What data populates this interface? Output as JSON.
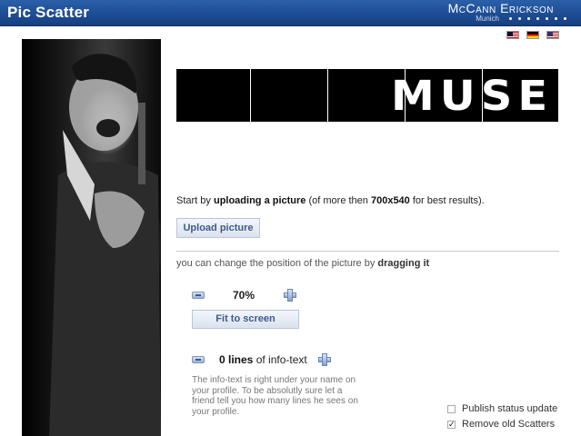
{
  "header": {
    "title": "Pic Scatter",
    "brand": "McCann Erickson",
    "brand_sub": "Munich"
  },
  "flags": [
    "malaysia-flag-icon",
    "germany-flag-icon",
    "usa-flag-icon"
  ],
  "banner": {
    "text": "MUSE"
  },
  "intro": {
    "prefix": "Start by ",
    "bold1": "uploading a picture",
    "mid": " (of more then ",
    "bold2": "700x540",
    "suffix": " for best results)."
  },
  "upload_button": "Upload picture",
  "drag_hint": {
    "prefix": "you can change the position of the picture by ",
    "bold": "dragging it"
  },
  "zoom": {
    "value": "70%",
    "fit_button": "Fit to screen"
  },
  "lines": {
    "count": "0 lines",
    "suffix": " of info-text",
    "description": "The info-text is right under your name on your profile. To be absolutly sure let a friend tell you how many lines he sees on your profile."
  },
  "options": [
    {
      "label": "Publish status update",
      "checked": false
    },
    {
      "label": "Remove old Scatters",
      "checked": true
    }
  ],
  "colors": {
    "header": "#1f4f96",
    "button_text": "#3b5a8a"
  }
}
